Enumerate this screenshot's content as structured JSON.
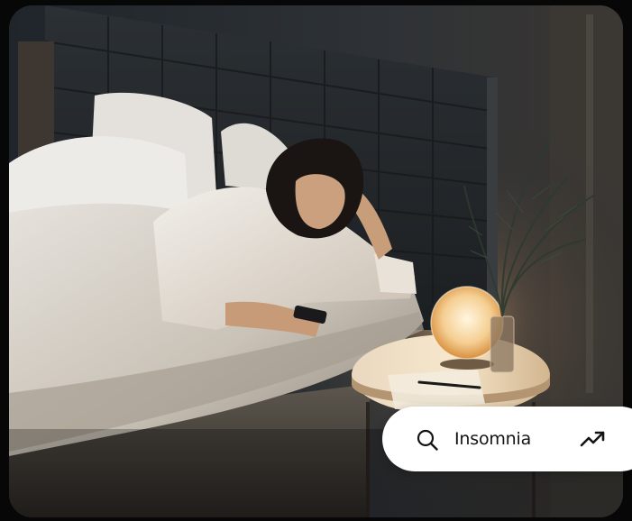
{
  "search": {
    "label": "Insomnia",
    "leading_icon": "search-icon",
    "trailing_icon": "trending-up-icon"
  },
  "colors": {
    "pill_background": "#ffffff",
    "pill_text": "#141414",
    "page_background": "#070708"
  }
}
